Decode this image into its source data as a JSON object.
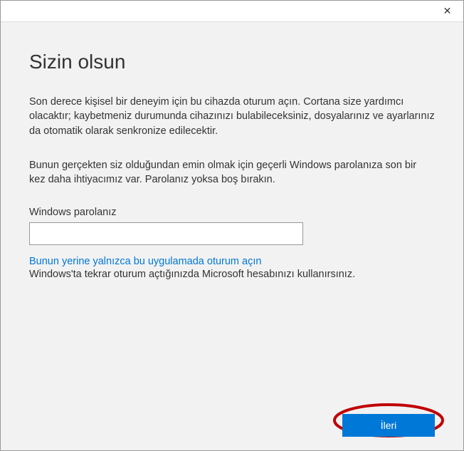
{
  "titlebar": {
    "close_label": "✕"
  },
  "content": {
    "heading": "Sizin olsun",
    "paragraph1": "Son derece kişisel bir deneyim için bu cihazda oturum açın. Cortana size yardımcı olacaktır; kaybetmeniz durumunda cihazınızı bulabileceksiniz, dosyalarınız ve ayarlarınız da otomatik olarak senkronize edilecektir.",
    "paragraph2": "Bunun gerçekten siz olduğundan emin olmak için geçerli Windows parolanıza son bir kez daha ihtiyacımız var. Parolanız yoksa boş bırakın.",
    "password_label": "Windows parolanız",
    "password_value": "",
    "link_text": "Bunun yerine yalnızca bu uygulamada oturum açın",
    "note_text": "Windows'ta tekrar oturum açtığınızda Microsoft hesabınızı kullanırsınız."
  },
  "footer": {
    "next_label": "İleri"
  }
}
